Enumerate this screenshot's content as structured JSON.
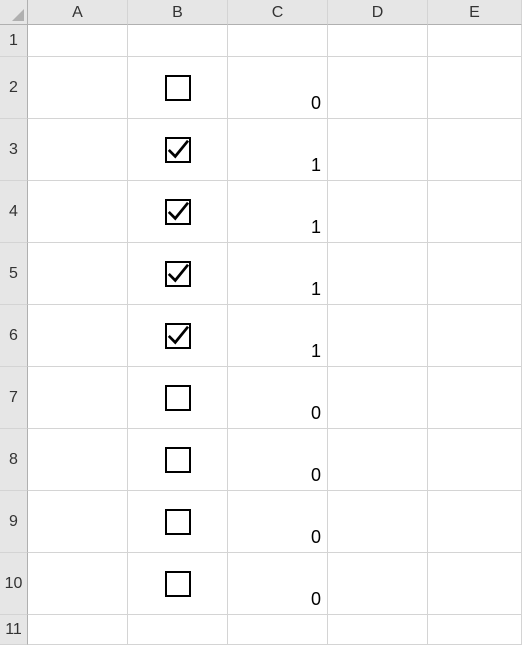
{
  "columns": {
    "A": "A",
    "B": "B",
    "C": "C",
    "D": "D",
    "E": "E"
  },
  "rows": {
    "r1": "1",
    "r2": "2",
    "r3": "3",
    "r4": "4",
    "r5": "5",
    "r6": "6",
    "r7": "7",
    "r8": "8",
    "r9": "9",
    "r10": "10",
    "r11": "11"
  },
  "checkboxes": {
    "b2": false,
    "b3": true,
    "b4": true,
    "b5": true,
    "b6": true,
    "b7": false,
    "b8": false,
    "b9": false,
    "b10": false
  },
  "values": {
    "c2": "0",
    "c3": "1",
    "c4": "1",
    "c5": "1",
    "c6": "1",
    "c7": "0",
    "c8": "0",
    "c9": "0",
    "c10": "0"
  }
}
